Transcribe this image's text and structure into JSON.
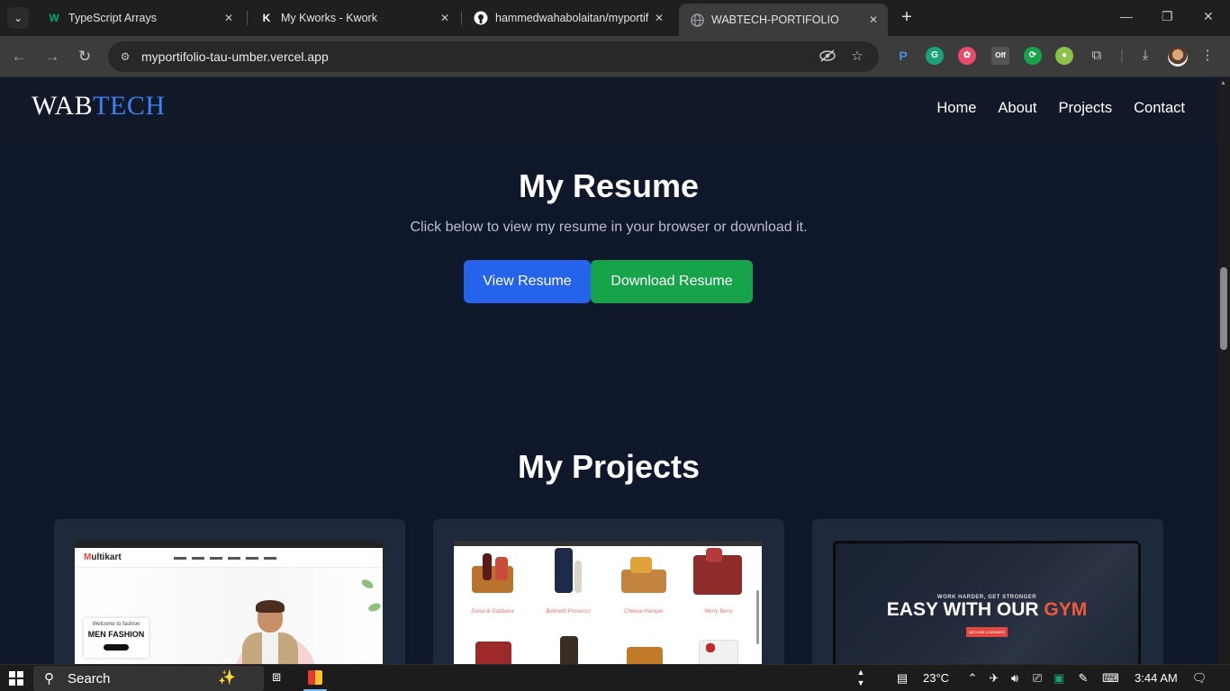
{
  "browser": {
    "tabs": [
      {
        "title": "TypeScript Arrays",
        "icon": "w-tutorial-icon",
        "color": "#04aa6d",
        "glyph": "W"
      },
      {
        "title": "My Kworks - Kwork",
        "icon": "kwork-k-icon",
        "color": "#ffffff",
        "glyph": "K"
      },
      {
        "title": "hammedwahabolaitan/myportif",
        "icon": "github-icon",
        "color": "#ffffff",
        "glyph": "●"
      },
      {
        "title": "WABTECH-PORTIFOLIO",
        "icon": "globe-icon",
        "color": "#9aa0a6",
        "glyph": "◍",
        "active": true
      }
    ],
    "url": "myportifolio-tau-umber.vercel.app"
  },
  "site": {
    "logo_part1": "WAB",
    "logo_part2": "TECH",
    "nav": [
      "Home",
      "About",
      "Projects",
      "Contact"
    ]
  },
  "resume": {
    "title": "My Resume",
    "subtitle": "Click below to view my resume in your browser or download it.",
    "view_label": "View Resume",
    "download_label": "Download Resume"
  },
  "projects": {
    "title": "My Projects",
    "p1": {
      "brand_rest": "ultikart",
      "brand_first": "M",
      "box_small": "Welcome to fashion",
      "box_big": "MEN FASHION"
    },
    "p2": {
      "labels": [
        "Dolce & Gabbana",
        "Bellinetti Prosecco",
        "Cheese Hamper",
        "Merry Berry"
      ]
    },
    "p3": {
      "small": "WORK HARDER, GET STRONGER",
      "title_a": "EASY WITH OUR ",
      "title_b": "GYM",
      "cta": "BECOME A MEMBER"
    }
  },
  "taskbar": {
    "search": "Search",
    "temperature": "23°C",
    "time": "3:44 AM"
  },
  "colors": {
    "page_bg": "#0f172a",
    "nav_bg": "#111827",
    "card_bg": "#1e293b",
    "accent_blue": "#2563eb",
    "accent_green": "#16a34a",
    "logo_blue": "#3b82f6"
  }
}
